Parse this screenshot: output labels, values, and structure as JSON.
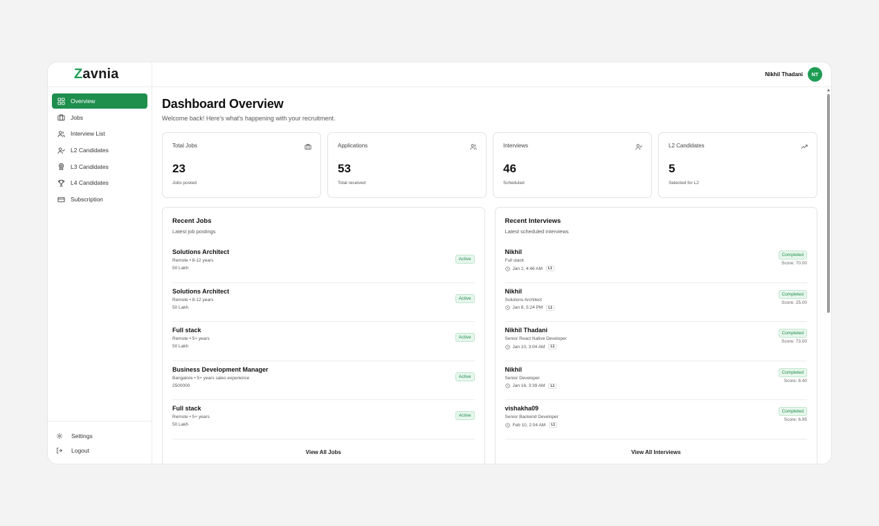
{
  "brand": {
    "logo_first": "Z",
    "logo_rest": "avnia",
    "accent": "#1f9d55"
  },
  "sidebar": {
    "items": [
      {
        "label": "Overview",
        "icon": "grid-icon",
        "active": true
      },
      {
        "label": "Jobs",
        "icon": "briefcase-icon"
      },
      {
        "label": "Interview List",
        "icon": "users-icon"
      },
      {
        "label": "L2 Candidates",
        "icon": "user-check-icon"
      },
      {
        "label": "L3 Candidates",
        "icon": "badge-icon"
      },
      {
        "label": "L4 Candidates",
        "icon": "trophy-icon"
      },
      {
        "label": "Subscription",
        "icon": "credit-card-icon"
      }
    ],
    "bottom": [
      {
        "label": "Settings",
        "icon": "gear-icon"
      },
      {
        "label": "Logout",
        "icon": "logout-icon"
      }
    ]
  },
  "header": {
    "user_name": "Nikhil Thadani",
    "avatar_initials": "NT"
  },
  "page": {
    "title": "Dashboard Overview",
    "subtitle": "Welcome back! Here's what's happening with your recruitment."
  },
  "stats": [
    {
      "label": "Total Jobs",
      "value": "23",
      "sub": "Jobs posted",
      "icon": "briefcase-icon"
    },
    {
      "label": "Applications",
      "value": "53",
      "sub": "Total received",
      "icon": "users-icon"
    },
    {
      "label": "Interviews",
      "value": "46",
      "sub": "Scheduled",
      "icon": "user-check-icon"
    },
    {
      "label": "L2 Candidates",
      "value": "5",
      "sub": "Selected for L2",
      "icon": "trending-up-icon"
    }
  ],
  "recent_jobs": {
    "title": "Recent Jobs",
    "subtitle": "Latest job postings",
    "view_all": "View All Jobs",
    "rows": [
      {
        "title": "Solutions Architect",
        "meta": "Remote • 8-12 years",
        "salary": "50 Lakh",
        "status": "Active"
      },
      {
        "title": "Solutions Architect",
        "meta": "Remote • 8-12 years",
        "salary": "50 Lakh",
        "status": "Active"
      },
      {
        "title": "Full stack",
        "meta": "Remote • 5+ years",
        "salary": "50 Lakh",
        "status": "Active"
      },
      {
        "title": "Business Development Manager",
        "meta": "Bangalore • 5+ years sales experience",
        "salary": "2500000",
        "status": "Active"
      },
      {
        "title": "Full stack",
        "meta": "Remote • 5+ years",
        "salary": "50 Lakh",
        "status": "Active"
      }
    ]
  },
  "recent_interviews": {
    "title": "Recent Interviews",
    "subtitle": "Latest scheduled interviews",
    "view_all": "View All Interviews",
    "rows": [
      {
        "name": "Nikhil",
        "role": "Full stack",
        "time": "Jan 2, 4:46 AM",
        "level": "L1",
        "status": "Completed",
        "score": "Score: 70.00"
      },
      {
        "name": "Nikhil",
        "role": "Solutions Architect",
        "time": "Jan 8, 5:24 PM",
        "level": "L1",
        "status": "Completed",
        "score": "Score: 25.00"
      },
      {
        "name": "Nikhil Thadani",
        "role": "Senior React Native Developer",
        "time": "Jan 10, 3:04 AM",
        "level": "L1",
        "status": "Completed",
        "score": "Score: 73.00"
      },
      {
        "name": "Nikhil",
        "role": "Senior Developer",
        "time": "Jan 16, 3:39 AM",
        "level": "L1",
        "status": "Completed",
        "score": "Score: 6.40"
      },
      {
        "name": "vishakha09",
        "role": "Senior Backend Developer",
        "time": "Feb 10, 2:04 AM",
        "level": "L1",
        "status": "Completed",
        "score": "Score: 6.95"
      }
    ]
  }
}
